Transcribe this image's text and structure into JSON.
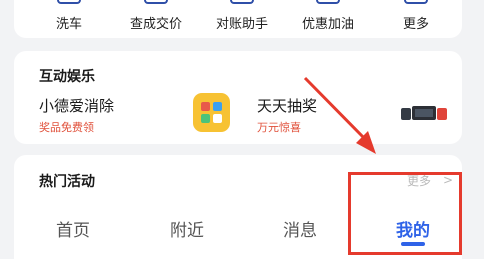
{
  "services": [
    {
      "label": "洗车",
      "icon": "car-wash-icon"
    },
    {
      "label": "查成交价",
      "icon": "price-query-icon"
    },
    {
      "label": "对账助手",
      "icon": "reconcile-icon"
    },
    {
      "label": "优惠加油",
      "icon": "fuel-discount-icon"
    },
    {
      "label": "更多",
      "icon": "more-icon"
    }
  ],
  "entertainment": {
    "title": "互动娱乐",
    "games": [
      {
        "name": "小德爱消除",
        "subtitle": "奖品免费领",
        "icon": "match-game-icon"
      },
      {
        "name": "天天抽奖",
        "subtitle": "万元惊喜",
        "icon": "lottery-game-icon"
      }
    ]
  },
  "hot": {
    "title": "热门活动",
    "more_label": "更多",
    "chevron": ">"
  },
  "tabs": [
    {
      "label": "首页"
    },
    {
      "label": "附近"
    },
    {
      "label": "消息"
    },
    {
      "label": "我的",
      "active": true
    }
  ],
  "colors": {
    "accent": "#2f63e8",
    "annotation": "#e53a2d",
    "subtitle": "#e0503a",
    "background": "#f2f3f5"
  }
}
